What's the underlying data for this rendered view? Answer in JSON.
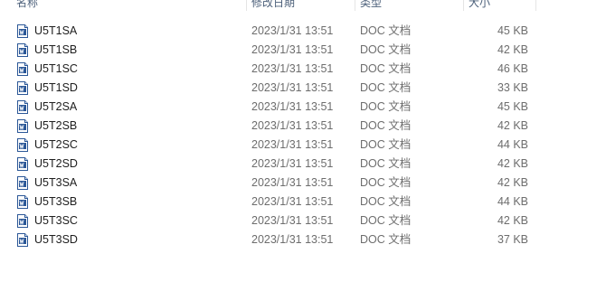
{
  "columns": {
    "name": "名称",
    "date": "修改日期",
    "type": "类型",
    "size": "大小"
  },
  "files": [
    {
      "name": "U5T1SA",
      "date": "2023/1/31 13:51",
      "type": "DOC 文档",
      "size": "45 KB",
      "icon": "word-doc-icon"
    },
    {
      "name": "U5T1SB",
      "date": "2023/1/31 13:51",
      "type": "DOC 文档",
      "size": "42 KB",
      "icon": "word-doc-icon"
    },
    {
      "name": "U5T1SC",
      "date": "2023/1/31 13:51",
      "type": "DOC 文档",
      "size": "46 KB",
      "icon": "word-doc-icon"
    },
    {
      "name": "U5T1SD",
      "date": "2023/1/31 13:51",
      "type": "DOC 文档",
      "size": "33 KB",
      "icon": "word-doc-icon"
    },
    {
      "name": "U5T2SA",
      "date": "2023/1/31 13:51",
      "type": "DOC 文档",
      "size": "45 KB",
      "icon": "word-doc-icon"
    },
    {
      "name": "U5T2SB",
      "date": "2023/1/31 13:51",
      "type": "DOC 文档",
      "size": "42 KB",
      "icon": "word-doc-icon"
    },
    {
      "name": "U5T2SC",
      "date": "2023/1/31 13:51",
      "type": "DOC 文档",
      "size": "44 KB",
      "icon": "word-doc-icon"
    },
    {
      "name": "U5T2SD",
      "date": "2023/1/31 13:51",
      "type": "DOC 文档",
      "size": "42 KB",
      "icon": "word-doc-icon"
    },
    {
      "name": "U5T3SA",
      "date": "2023/1/31 13:51",
      "type": "DOC 文档",
      "size": "42 KB",
      "icon": "word-doc-icon"
    },
    {
      "name": "U5T3SB",
      "date": "2023/1/31 13:51",
      "type": "DOC 文档",
      "size": "44 KB",
      "icon": "word-doc-icon"
    },
    {
      "name": "U5T3SC",
      "date": "2023/1/31 13:51",
      "type": "DOC 文档",
      "size": "42 KB",
      "icon": "word-doc-icon"
    },
    {
      "name": "U5T3SD",
      "date": "2023/1/31 13:51",
      "type": "DOC 文档",
      "size": "37 KB",
      "icon": "word-doc-icon"
    }
  ],
  "colors": {
    "header_text": "#4c607a",
    "name_text": "#1e1e1e",
    "meta_text": "#6d6d6d",
    "icon_blue": "#2b5797"
  }
}
